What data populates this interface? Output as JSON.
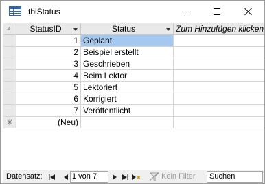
{
  "window": {
    "title": "tblStatus",
    "icon": "table-icon"
  },
  "grid": {
    "columns": [
      {
        "label": "StatusID",
        "sort_icon": "dropdown-arrow-icon"
      },
      {
        "label": "Status",
        "sort_icon": "dropdown-arrow-icon"
      },
      {
        "label": "Zum Hinzufügen klicken"
      }
    ],
    "rows": [
      {
        "id": "1",
        "status": "Geplant"
      },
      {
        "id": "2",
        "status": "Beispiel erstellt"
      },
      {
        "id": "3",
        "status": "Geschrieben"
      },
      {
        "id": "4",
        "status": "Beim Lektor"
      },
      {
        "id": "5",
        "status": "Lektoriert"
      },
      {
        "id": "6",
        "status": "Korrigiert"
      },
      {
        "id": "7",
        "status": "Veröffentlicht"
      }
    ],
    "new_row": {
      "marker": "✳",
      "id": "(Neu)"
    },
    "selected_row_index": 0,
    "selection_color": "#a4c8f0"
  },
  "navigation": {
    "label": "Datensatz:",
    "position": "1 von 7",
    "first_icon": "first-record-icon",
    "prev_icon": "prev-record-icon",
    "next_icon": "next-record-icon",
    "last_icon": "last-record-icon",
    "new_icon": "new-record-icon",
    "filter_text": "Kein Filter",
    "search_text": "Suchen"
  }
}
